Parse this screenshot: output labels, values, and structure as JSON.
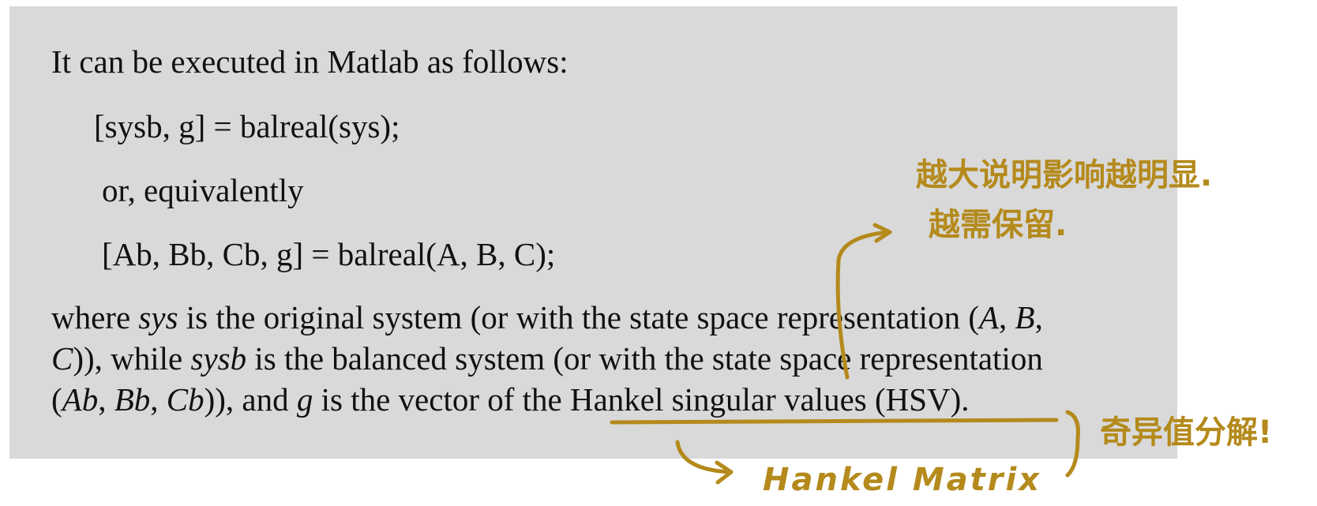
{
  "text": {
    "intro": "It can be executed in Matlab as follows:",
    "code1": "[sysb, g] = balreal(sys);",
    "or_line": "or, equivalently",
    "code2": "[Ab, Bb, Cb, g] = balreal(A, B, C);",
    "para": {
      "l1": {
        "a": "where ",
        "b": "sys",
        "c": " is the original system (or with the state space representation (",
        "d": "A",
        "e": ", ",
        "f": "B",
        "g": ","
      },
      "l2": {
        "a": "C",
        "b": ")), while ",
        "c": "sysb",
        "d": " is the balanced system (or with the state space representation"
      },
      "l3": {
        "a": "(",
        "b": "Ab",
        "c": ", ",
        "d": "Bb",
        "e": ", ",
        "f": "Cb",
        "g": ")), and ",
        "h": "g",
        "i": " is the vector of the ",
        "j": "Hankel singular values (HSV)."
      }
    }
  },
  "annotations": {
    "note1_line1": "越大说明影响越明显.",
    "note1_line2": "越需保留.",
    "note2": "Hankel Matrix",
    "note3": "奇异值分解!",
    "ink_color": "#b48a1c"
  }
}
